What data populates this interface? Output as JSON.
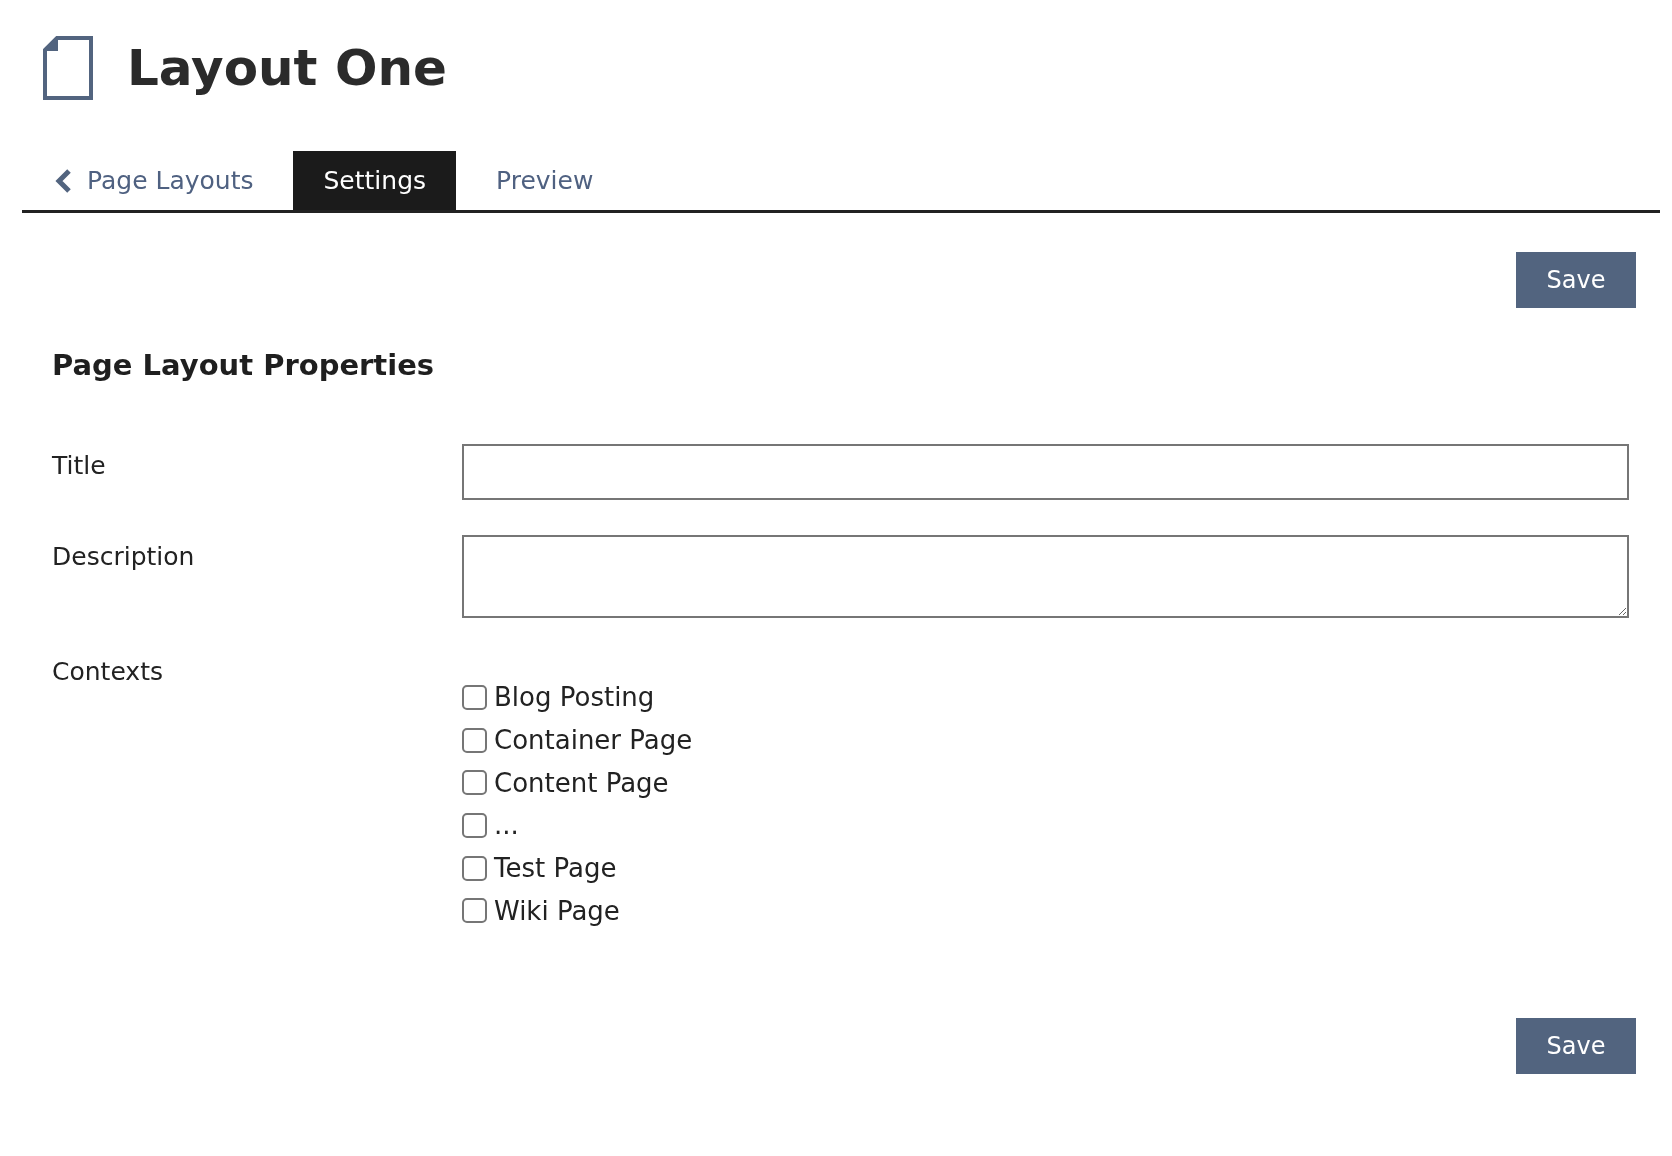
{
  "header": {
    "title": "Layout One"
  },
  "tabs": [
    {
      "label": "Page Layouts",
      "kind": "back",
      "selected": false
    },
    {
      "label": "Settings",
      "kind": "tab",
      "selected": true
    },
    {
      "label": "Preview",
      "kind": "tab",
      "selected": false
    }
  ],
  "top_actions": {
    "save_button": "Save"
  },
  "form": {
    "heading": "Page Layout Properties",
    "fields": [
      {
        "label": "Title",
        "kind": "text"
      },
      {
        "label": "Description",
        "kind": "textarea"
      },
      {
        "label": "Contexts",
        "kind": "checkboxes",
        "options": [
          {
            "label": "Blog Posting",
            "checked": false
          },
          {
            "label": "Container Page",
            "checked": false
          },
          {
            "label": "Content Page",
            "checked": false
          },
          {
            "label": "...",
            "checked": false
          },
          {
            "label": "Test Page",
            "checked": false
          },
          {
            "label": "Wiki Page",
            "checked": false
          }
        ]
      }
    ]
  },
  "bottom_actions": {
    "save_button": "Save"
  }
}
